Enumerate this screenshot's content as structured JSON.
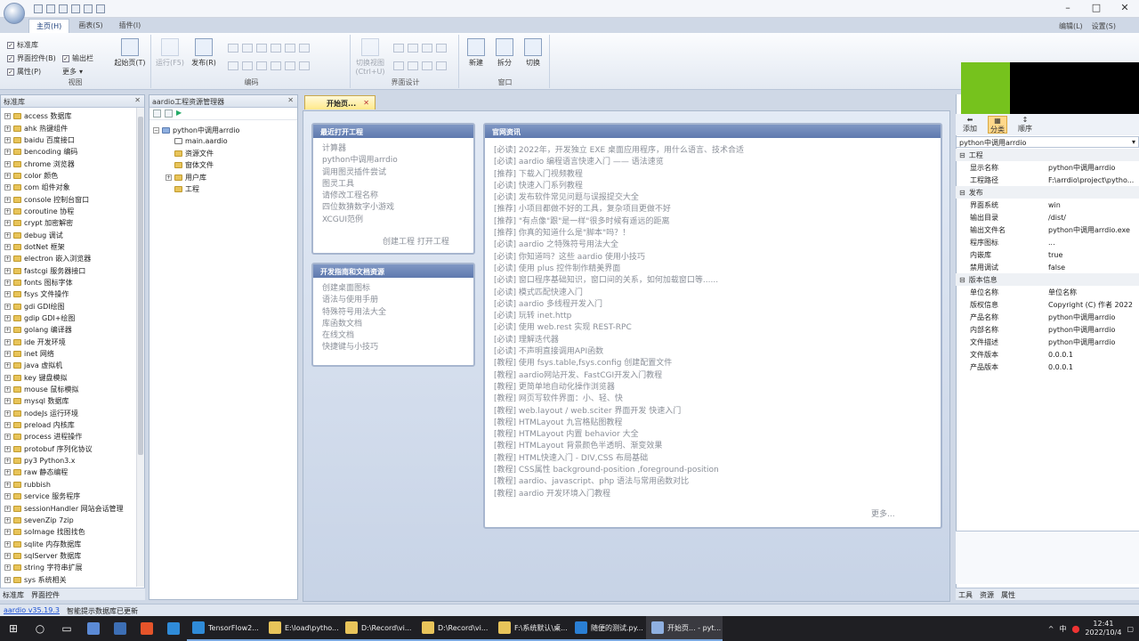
{
  "ribbon": {
    "tabs": [
      "主页(H)",
      "画表(S)",
      "插件(I)"
    ],
    "active_tab": "主页(H)",
    "top_right": [
      "编辑(L)",
      "设置(S)"
    ],
    "view_group": {
      "label": "视图",
      "checks": [
        "标准库",
        "界面控件(B)",
        "属性(P)"
      ],
      "extras": [
        "输出栏",
        "更多"
      ]
    },
    "start_button": "起始页(T)",
    "run_button": "运行(F5)",
    "publish_button": "发布(R)",
    "code_group_label": "编码",
    "toggle_view": "切换视图",
    "toggle_view_key": "(Ctrl+U)",
    "ui_group_label": "界面设计",
    "window_group": {
      "label": "窗口",
      "buttons": [
        "新建",
        "拆分",
        "切换"
      ]
    }
  },
  "library": {
    "title": "标准库",
    "items": [
      "access 数据库",
      "ahk 热键组件",
      "baidu 百度接口",
      "bencoding 编码",
      "chrome 浏览器",
      "color 颜色",
      "com 组件对象",
      "console 控制台窗口",
      "coroutine 协程",
      "crypt 加密解密",
      "debug 调试",
      "dotNet 框架",
      "electron 嵌入浏览器",
      "fastcgi 服务器接口",
      "fonts 图标字体",
      "fsys 文件操作",
      "gdi GDI绘图",
      "gdip GDI+绘图",
      "golang 编译器",
      "ide 开发环境",
      "inet 网络",
      "java 虚拟机",
      "key 键盘模拟",
      "mouse 鼠标模拟",
      "mysql 数据库",
      "nodeJs 运行环境",
      "preload 内核库",
      "process 进程操作",
      "protobuf 序列化协议",
      "py3 Python3.x",
      "raw 静态编程",
      "rubbish",
      "service 服务程序",
      "sessionHandler 网站会话管理",
      "sevenZip 7zip",
      "soImage 找图找色",
      "sqlite 内存数据库",
      "sqlServer 数据库",
      "string 字符串扩展",
      "sys 系统相关"
    ],
    "bottom_tabs": [
      "标准库",
      "界面控件"
    ]
  },
  "project": {
    "title": "aardio工程资源管理器",
    "root": "python中调用arrdio",
    "children": [
      "main.aardio",
      "资源文件",
      "窗体文件",
      "用户库",
      "工程"
    ]
  },
  "document": {
    "tab_label": "开始页...",
    "recent": {
      "title": "最近打开工程",
      "items": [
        "计算器",
        "python中调用arrdio",
        "调用图灵插件尝试",
        "图灵工具",
        "请修改工程名称",
        "四位数猜数字小游戏",
        "XCGUI范例"
      ],
      "actions": "创建工程 打开工程"
    },
    "guide": {
      "title": "开发指南和文档资源",
      "items": [
        "创建桌面图标",
        "语法与使用手册",
        "特殊符号用法大全",
        "库函数文档",
        "在线文档",
        "快捷键与小技巧"
      ]
    },
    "news": {
      "title": "官网资讯",
      "items": [
        "[必读] 2022年，开发独立 EXE 桌面应用程序，用什么语言、技术合适",
        "[必读] aardio 编程语言快速入门 —— 语法速览",
        "[推荐] 下载入门视频教程",
        "[必读] 快速入门系列教程",
        "[必读] 发布软件常见问题与误报提交大全",
        "[推荐] 小项目都做不好的工具，复杂项目更做不好",
        "[推荐] \"有点像\"跟\"是一样\"很多时候有遥远的距离",
        "[推荐] 你真的知道什么是\"脚本\"吗？！",
        "[必读] aardio 之特殊符号用法大全",
        "[必读] 你知道吗？这些 aardio 使用小技巧",
        "[必读] 使用 plus 控件制作精美界面",
        "[必读] 窗口程序基础知识，窗口间的关系，如何加载窗口等......",
        "[必读] 模式匹配快速入门",
        "[必读] aardio 多线程开发入门",
        "[必读] 玩转 inet.http",
        "[必读] 使用 web.rest 实现 REST-RPC",
        "[必读] 理解迭代器",
        "[必读] 不声明直接调用API函数",
        "[教程] 使用 fsys.table,fsys.config 创建配置文件",
        "[教程] aardio网站开发、FastCGI开发入门教程",
        "[教程] 更简单地自动化操作浏览器",
        "[教程] 网页写软件界面：小、轻、快",
        "[教程] web.layout / web.sciter 界面开发 快速入门",
        "[教程] HTMLayout 九宫格贴图教程",
        "[教程] HTMLayout 内置 behavior 大全",
        "[教程] HTMLayout 背景颜色半透明、渐变效果",
        "[教程] HTML快速入门 - DIV,CSS 布局基础",
        "[教程] CSS属性 background-position ,foreground-position",
        "[教程] aardio、javascript、php 语法与常用函数对比",
        "[教程] aardio 开发环境入门教程"
      ],
      "more": "更多..."
    }
  },
  "properties": {
    "tools": [
      "添加",
      "分类",
      "顺序"
    ],
    "combo": "python中调用arrdio",
    "sections": [
      {
        "name": "工程",
        "rows": [
          [
            "显示名称",
            "python中调用arrdio"
          ],
          [
            "工程路径",
            "F:\\arrdio\\project\\pytho..."
          ]
        ]
      },
      {
        "name": "发布",
        "rows": [
          [
            "界面系统",
            "win"
          ],
          [
            "输出目录",
            "/dist/"
          ],
          [
            "输出文件名",
            "python中调用arrdio.exe"
          ],
          [
            "程序图标",
            "..."
          ],
          [
            "内嵌库",
            "true"
          ],
          [
            "禁用调试",
            "false"
          ]
        ]
      },
      {
        "name": "版本信息",
        "rows": [
          [
            "单位名称",
            "单位名称"
          ],
          [
            "版权信息",
            "Copyright (C) 作者 2022"
          ],
          [
            "产品名称",
            "python中调用arrdio"
          ],
          [
            "内部名称",
            "python中调用arrdio"
          ],
          [
            "文件描述",
            "python中调用arrdio"
          ],
          [
            "文件版本",
            "0.0.0.1"
          ],
          [
            "产品版本",
            "0.0.0.1"
          ]
        ]
      }
    ],
    "bottom_tabs": [
      "工具",
      "资源",
      "属性"
    ]
  },
  "status": {
    "version": "aardio v35.19.3",
    "message": "智能提示数据库已更新"
  },
  "taskbar": {
    "items": [
      "TensorFlow2...",
      "E:\\load\\pytho...",
      "D:\\Record\\vi...",
      "D:\\Record\\vi...",
      "F:\\系统默认\\桌...",
      "随便的测试.py...",
      "开始页... - pyt..."
    ],
    "active_index": 6,
    "time": "12:41",
    "date": "2022/10/4",
    "ime": "中"
  }
}
